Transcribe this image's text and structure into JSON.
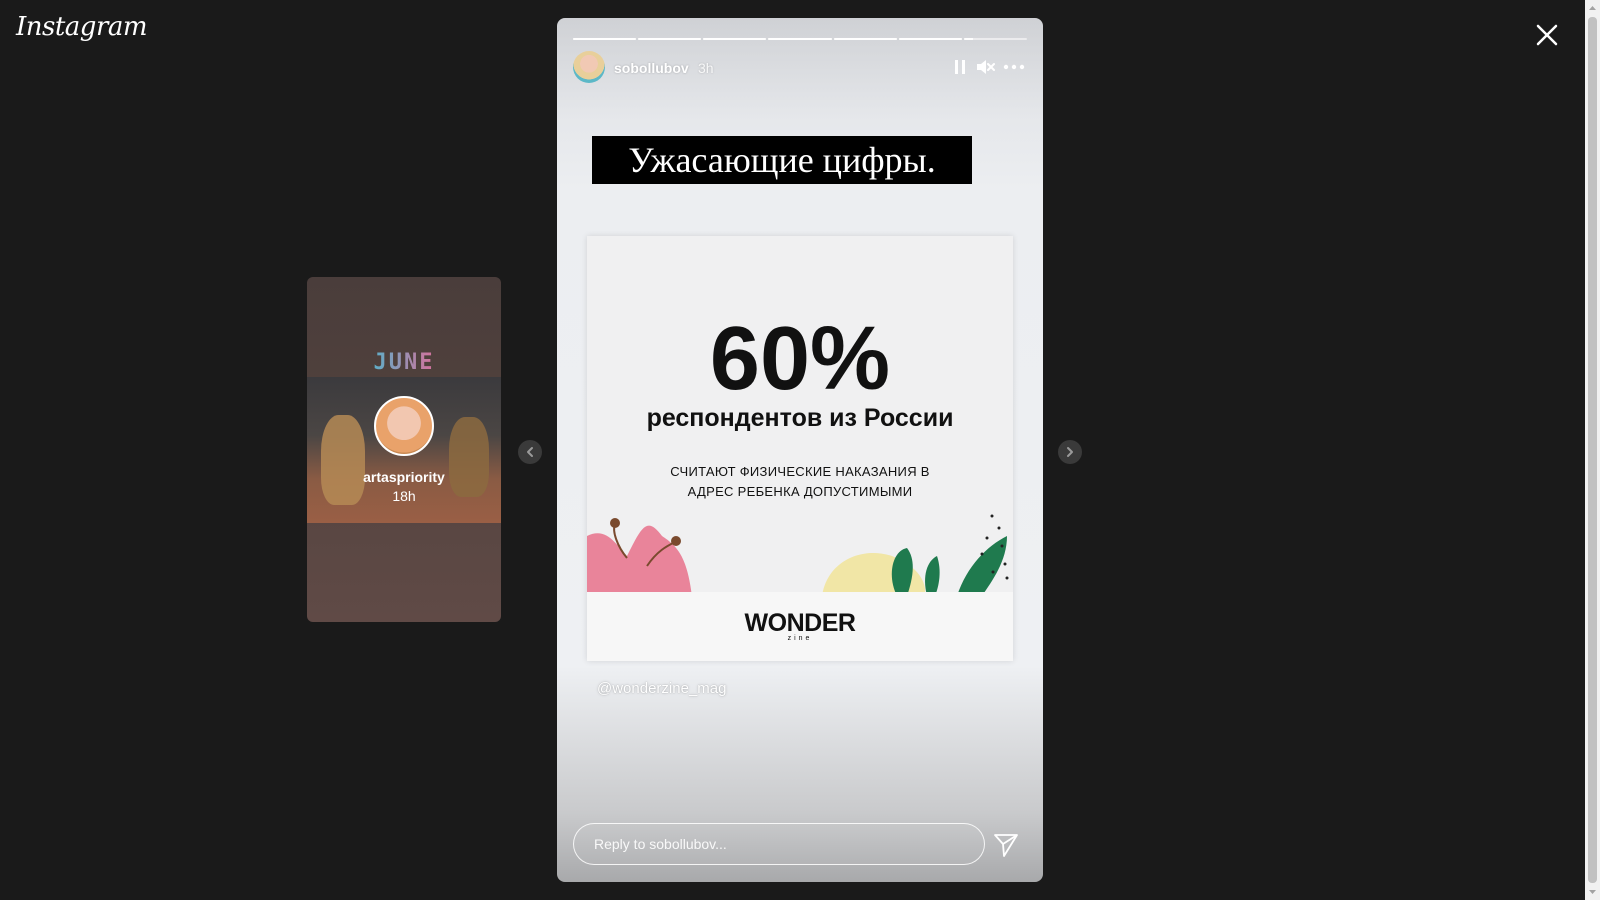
{
  "app": {
    "logo": "Instagram"
  },
  "preview": {
    "sticker_text": "JUNE",
    "username": "artaspriority",
    "time": "18h"
  },
  "story": {
    "progress": {
      "segments": 7,
      "completed": 6,
      "current_fraction": 0.15
    },
    "username": "sobollubov",
    "time": "3h",
    "headline": "Ужасающие цифры.",
    "card": {
      "big_number": "60%",
      "line1": "респондентов из России",
      "line2": "СЧИТАЮТ ФИЗИЧЕСКИЕ НАКАЗАНИЯ В АДРЕС РЕБЕНКА ДОПУСТИМЫМИ",
      "brand": "WONDER",
      "brand_sub": "zine"
    },
    "mention": "@wonderzine_mag",
    "reply_placeholder": "Reply to sobollubov..."
  },
  "icons": {
    "close": "close-icon",
    "pause": "pause-icon",
    "mute": "muted-speaker-icon",
    "more": "more-options-icon",
    "send": "send-icon",
    "prev": "chevron-left-icon",
    "next": "chevron-right-icon"
  },
  "colors": {
    "background": "#1a1a1a",
    "headline_bg": "#000000"
  }
}
